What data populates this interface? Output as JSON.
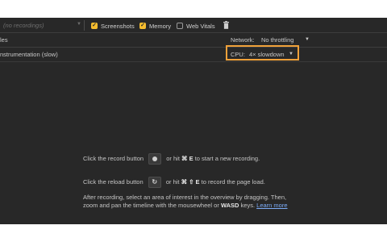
{
  "toolbar": {
    "recording_select": "(no recordings)",
    "screenshots_label": "Screenshots",
    "memory_label": "Memory",
    "web_vitals_label": "Web Vitals",
    "screenshots_checked": true,
    "memory_checked": true,
    "web_vitals_checked": false
  },
  "settings": {
    "row2_left": "les",
    "network_label": "Network:",
    "network_value": "No throttling",
    "row3_left": "nstrumentation (slow)",
    "cpu_label": "CPU:",
    "cpu_value": "4× slowdown"
  },
  "empty_state": {
    "line1_pre": "Click the record button",
    "line1_post_pre": "or hit",
    "line1_keys": "⌘ E",
    "line1_post": "to start a new recording.",
    "line2_pre": "Click the reload button",
    "line2_post_pre": "or hit",
    "line2_keys": "⌘ ⇧ E",
    "line2_post": "to record the page load.",
    "line3": "After recording, select an area of interest in the overview by dragging. Then,",
    "line4_pre": "zoom and pan the timeline with the mousewheel or",
    "line4_keys": "WASD",
    "line4_post": "keys.",
    "learn_more": "Learn more"
  },
  "colors": {
    "panel_bg": "#282828",
    "checkbox_accent": "#f5bc2f",
    "highlight_border": "#f0a13a",
    "link": "#7cacf8"
  }
}
